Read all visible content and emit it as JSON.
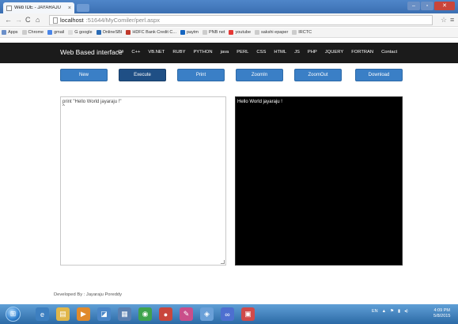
{
  "browser": {
    "tab_title": "Web IDE - JAYARAJU",
    "tab_close": "×",
    "url_host": "localhost",
    "url_path": ":51644/MyComiler/perl.aspx",
    "bookmarks": [
      {
        "label": "Apps",
        "color": "#6b8fc9"
      },
      {
        "label": "Chrome",
        "color": "#cccccc"
      },
      {
        "label": "gmail",
        "color": "#4a86e8"
      },
      {
        "label": "G google",
        "color": "#dddddd"
      },
      {
        "label": "OnlineSBI",
        "color": "#2a6bb5"
      },
      {
        "label": "HDFC Bank Credit C...",
        "color": "#c0392b"
      },
      {
        "label": "paytm",
        "color": "#1565c0"
      },
      {
        "label": "PNB net",
        "color": "#cccccc"
      },
      {
        "label": "youtube",
        "color": "#e53935"
      },
      {
        "label": "sakshi epaper",
        "color": "#cccccc"
      },
      {
        "label": "IRCTC",
        "color": "#cccccc"
      }
    ]
  },
  "site": {
    "brand": "Web Based interface",
    "nav": [
      "C#",
      "C++",
      "VB.NET",
      "RUBY",
      "PYTHON",
      "java",
      "PERL",
      "CSS",
      "HTML",
      "JS",
      "PHP",
      "JQUERY",
      "FORTRAN",
      "Contact"
    ]
  },
  "actions": {
    "new": "New",
    "execute": "Execute",
    "print": "Print",
    "zoomin": "ZoomIn",
    "zoomout": "ZoomOut",
    "download": "Download"
  },
  "editor": {
    "code": "print \"Hello World jayaraju !\"",
    "cursor": "^"
  },
  "output": {
    "text": "Hello World jayaraju !"
  },
  "footer": {
    "credit": "Developed By : Jayaraju Poreddy"
  },
  "taskbar": {
    "tray_lang": "EN",
    "clock_time": "4:09 PM",
    "clock_date": "5/8/2015"
  },
  "colors": {
    "nav_bg": "#1b1b1b",
    "button_blue": "#3a7fc6",
    "button_active": "#1f4f85",
    "output_bg": "#000000"
  }
}
